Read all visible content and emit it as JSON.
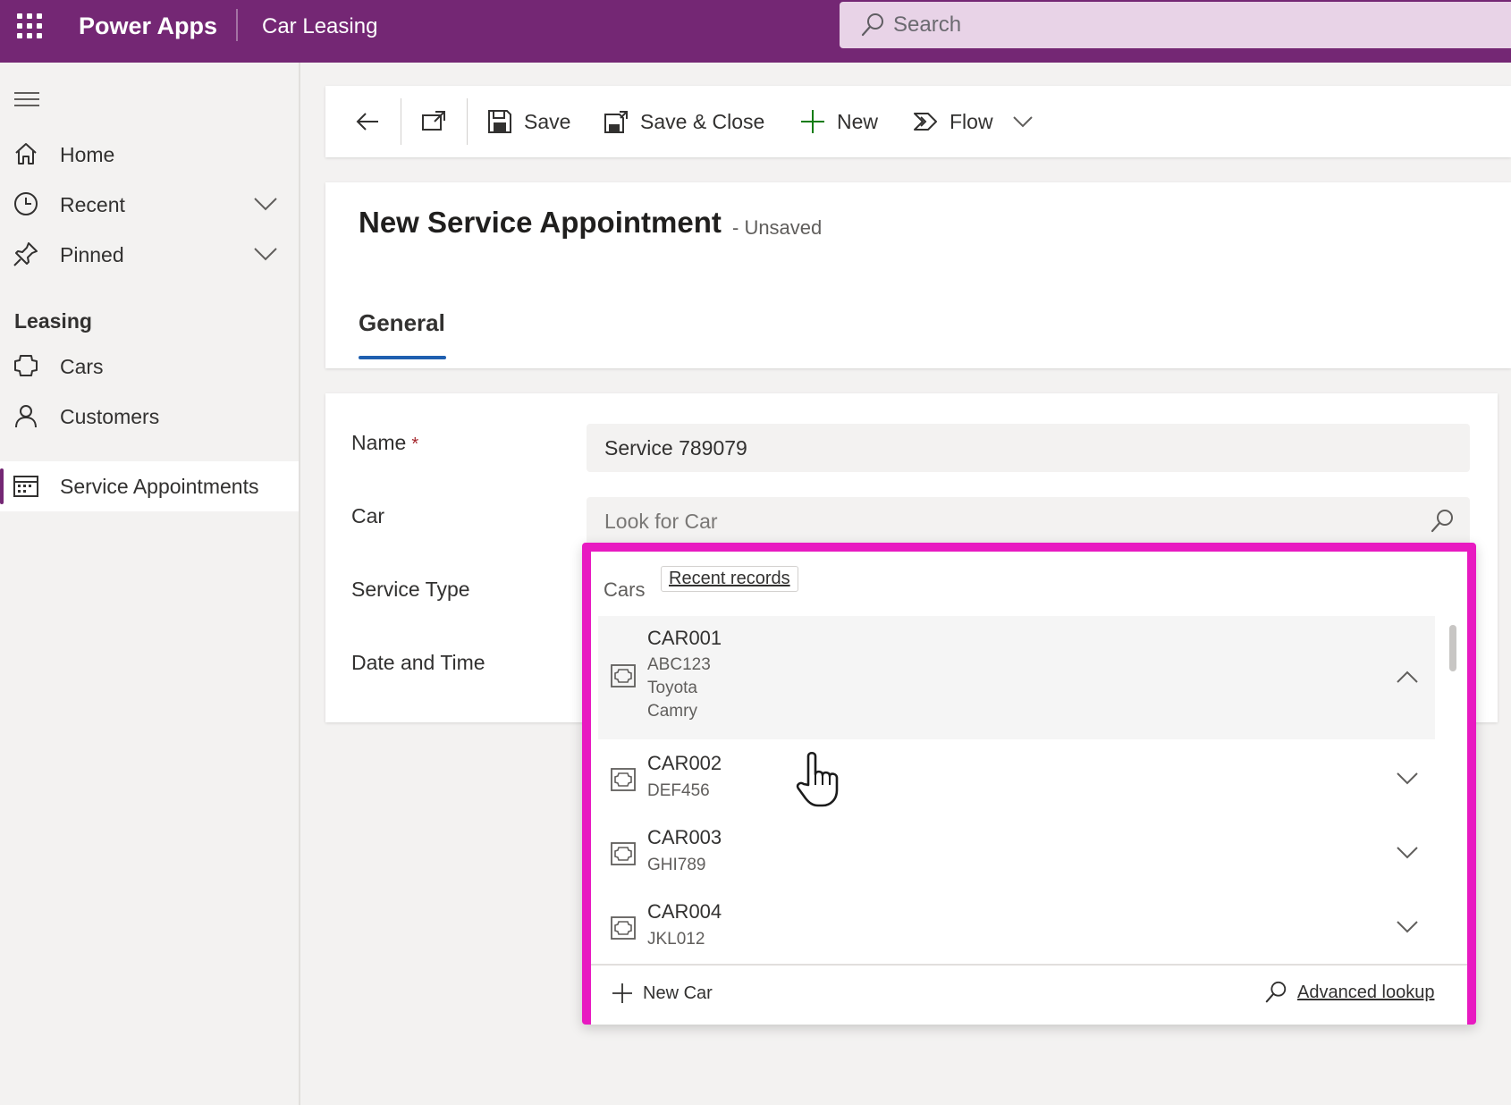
{
  "topbar": {
    "app_name": "Power Apps",
    "environment": "Car Leasing",
    "search_placeholder": "Search",
    "bar_color": "#742774"
  },
  "sidebar": {
    "items": [
      {
        "label": "Home",
        "icon": "home-icon"
      },
      {
        "label": "Recent",
        "icon": "clock-icon",
        "expandable": true
      },
      {
        "label": "Pinned",
        "icon": "pin-icon",
        "expandable": true
      }
    ],
    "section_title": "Leasing",
    "section_items": [
      {
        "label": "Cars",
        "icon": "car-entity-icon"
      },
      {
        "label": "Customers",
        "icon": "person-icon"
      },
      {
        "label": "Service Appointments",
        "icon": "calendar-icon",
        "selected": true
      }
    ]
  },
  "toolbar": {
    "save_label": "Save",
    "save_close_label": "Save & Close",
    "new_label": "New",
    "flow_label": "Flow"
  },
  "form": {
    "title": "New Service Appointment",
    "status": "- Unsaved",
    "tab_general": "General",
    "fields": {
      "name_label": "Name",
      "name_required": "*",
      "name_value": "Service 789079",
      "car_label": "Car",
      "car_placeholder": "Look for Car",
      "service_type_label": "Service Type",
      "date_time_label": "Date and Time"
    }
  },
  "lookup": {
    "header_title": "Cars",
    "recent_records": "Recent records",
    "highlight_color": "#e81ac1",
    "rows": [
      {
        "id": "CAR001",
        "details": [
          "ABC123",
          "Toyota",
          "Camry"
        ],
        "expanded": true
      },
      {
        "id": "CAR002",
        "details": [
          "DEF456"
        ],
        "expanded": false
      },
      {
        "id": "CAR003",
        "details": [
          "GHI789"
        ],
        "expanded": false
      },
      {
        "id": "CAR004",
        "details": [
          "JKL012"
        ],
        "expanded": false
      }
    ],
    "new_label": "New Car",
    "advanced_label": "Advanced lookup"
  }
}
